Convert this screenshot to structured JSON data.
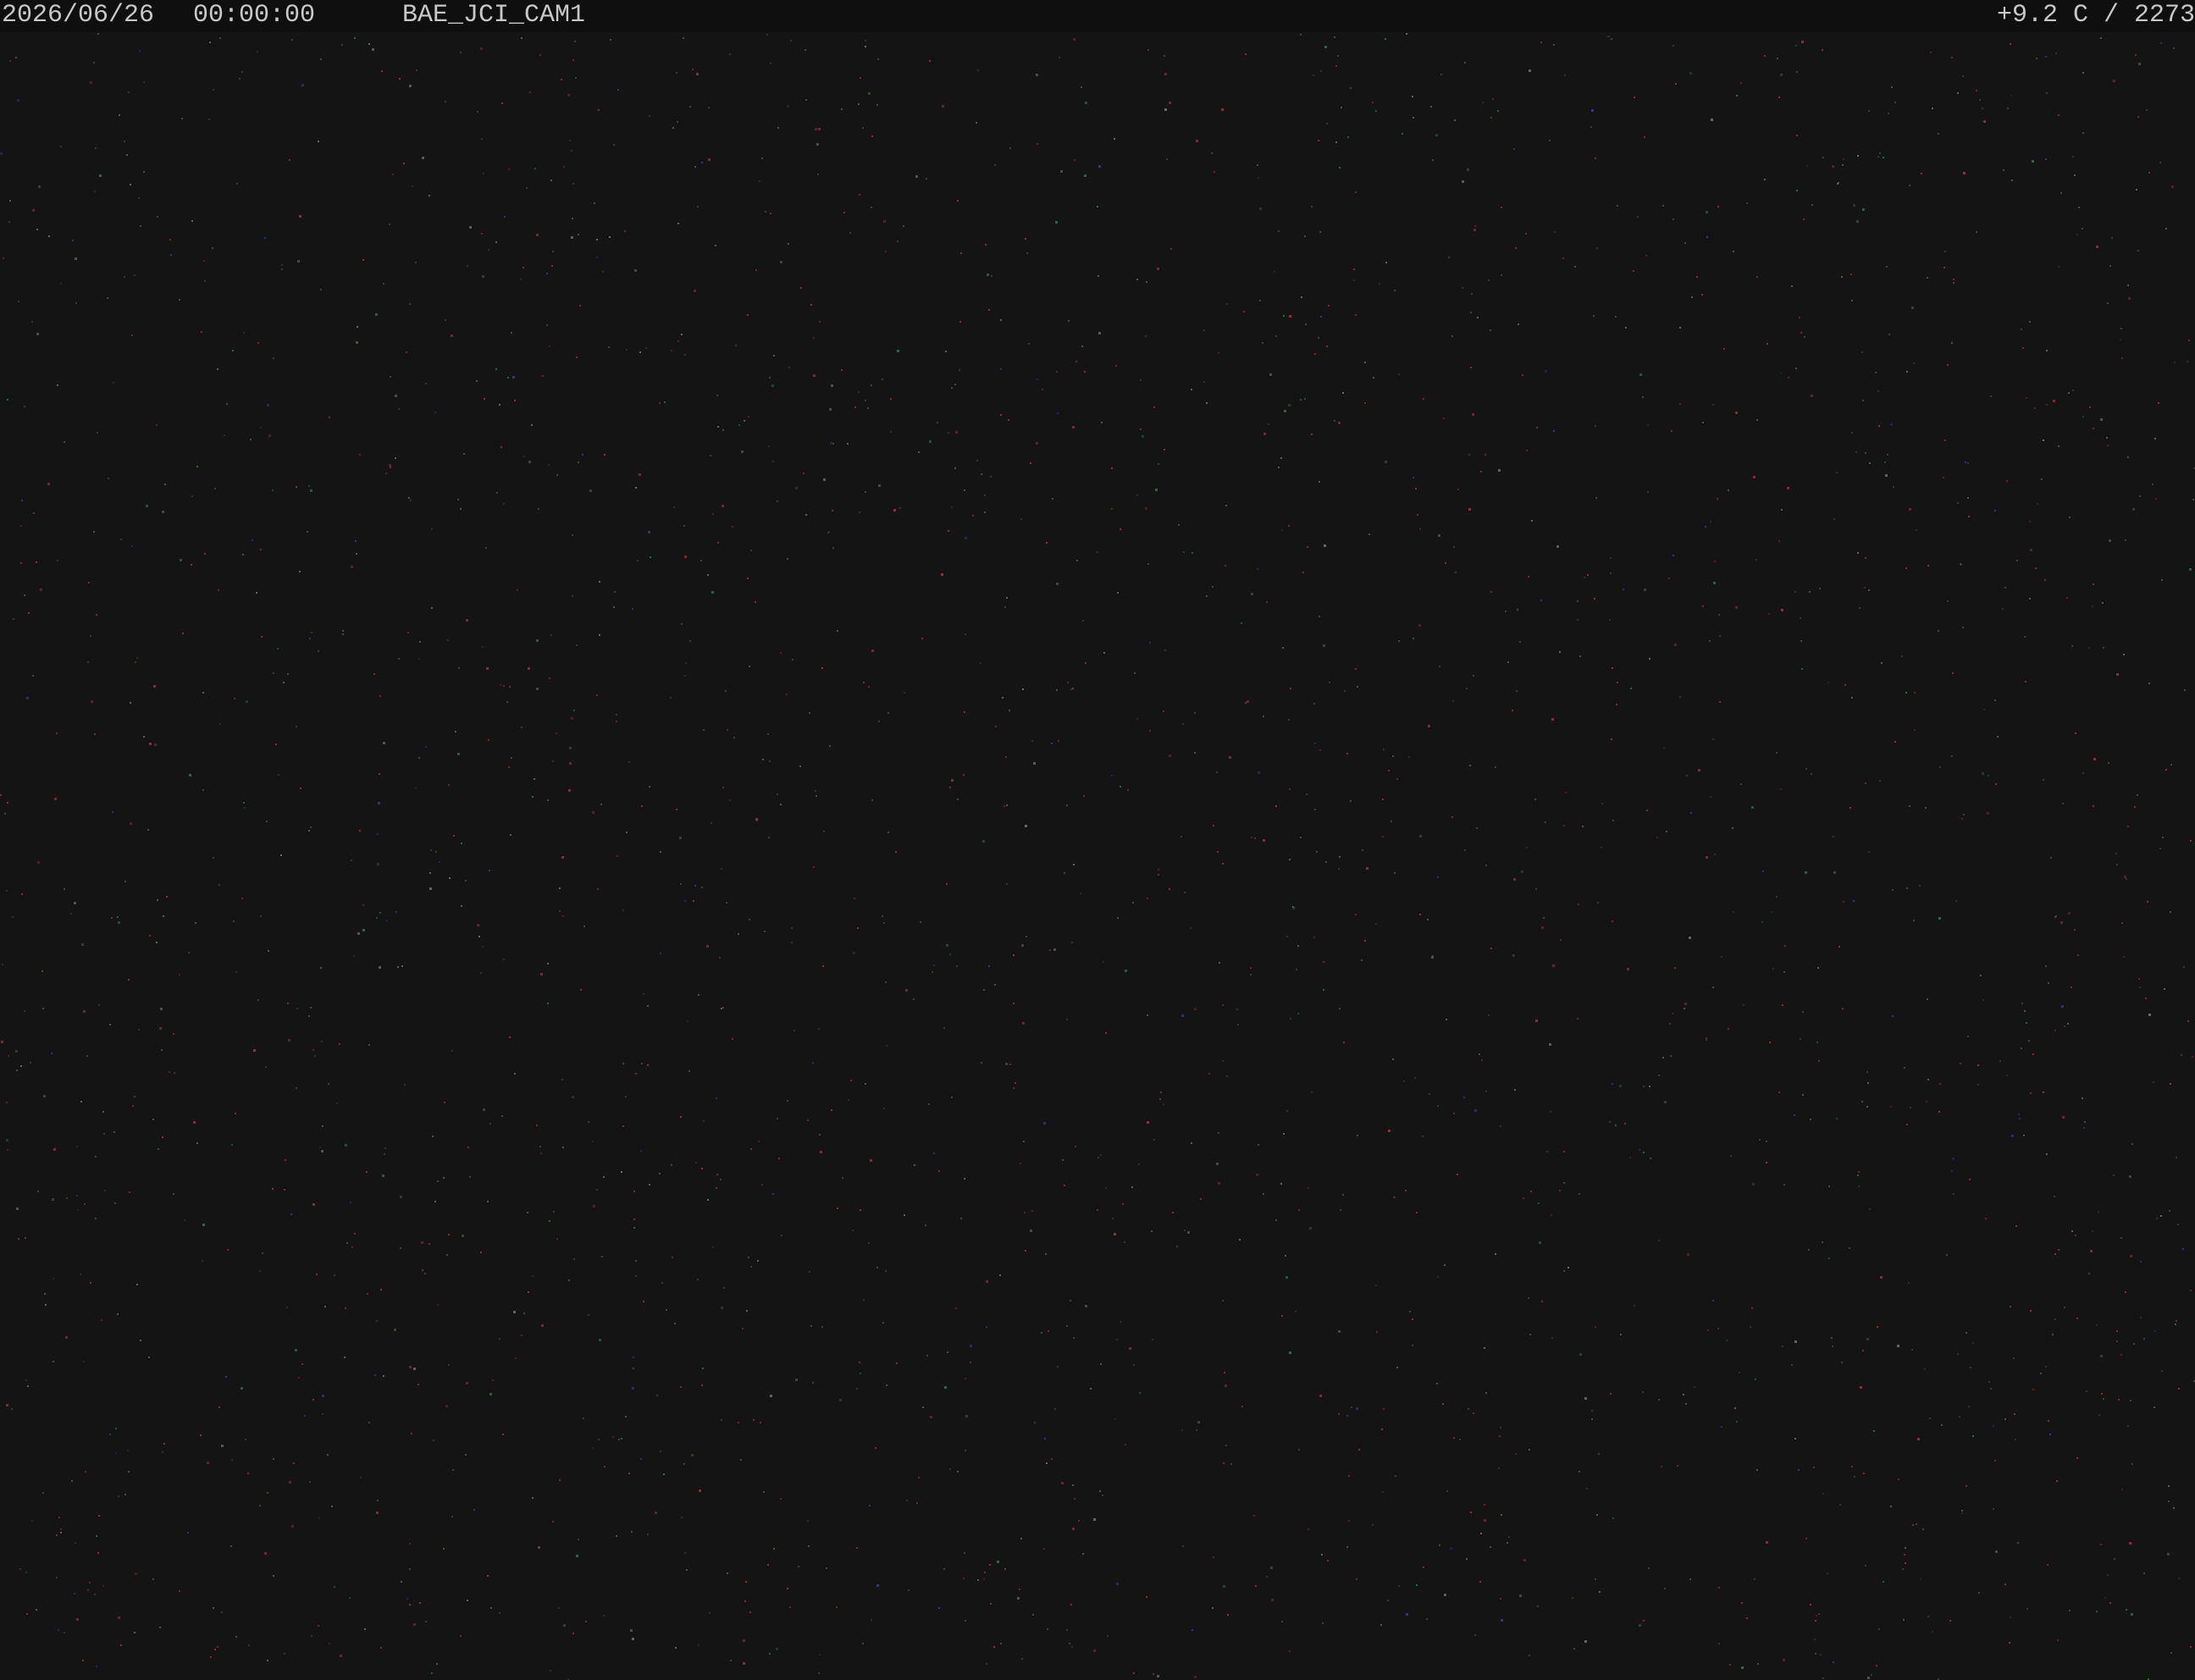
{
  "overlay": {
    "date": "2026/06/26",
    "time": "00:00:00",
    "camera_name": "BAE_JCI_CAM1",
    "status": "+9.2 C / 2273"
  },
  "image": {
    "scene": "night sky noise",
    "background_color": "#141414",
    "noise_colors": [
      "#b03040",
      "#3a7a4a",
      "#3040a0",
      "#7a7a7a"
    ]
  }
}
